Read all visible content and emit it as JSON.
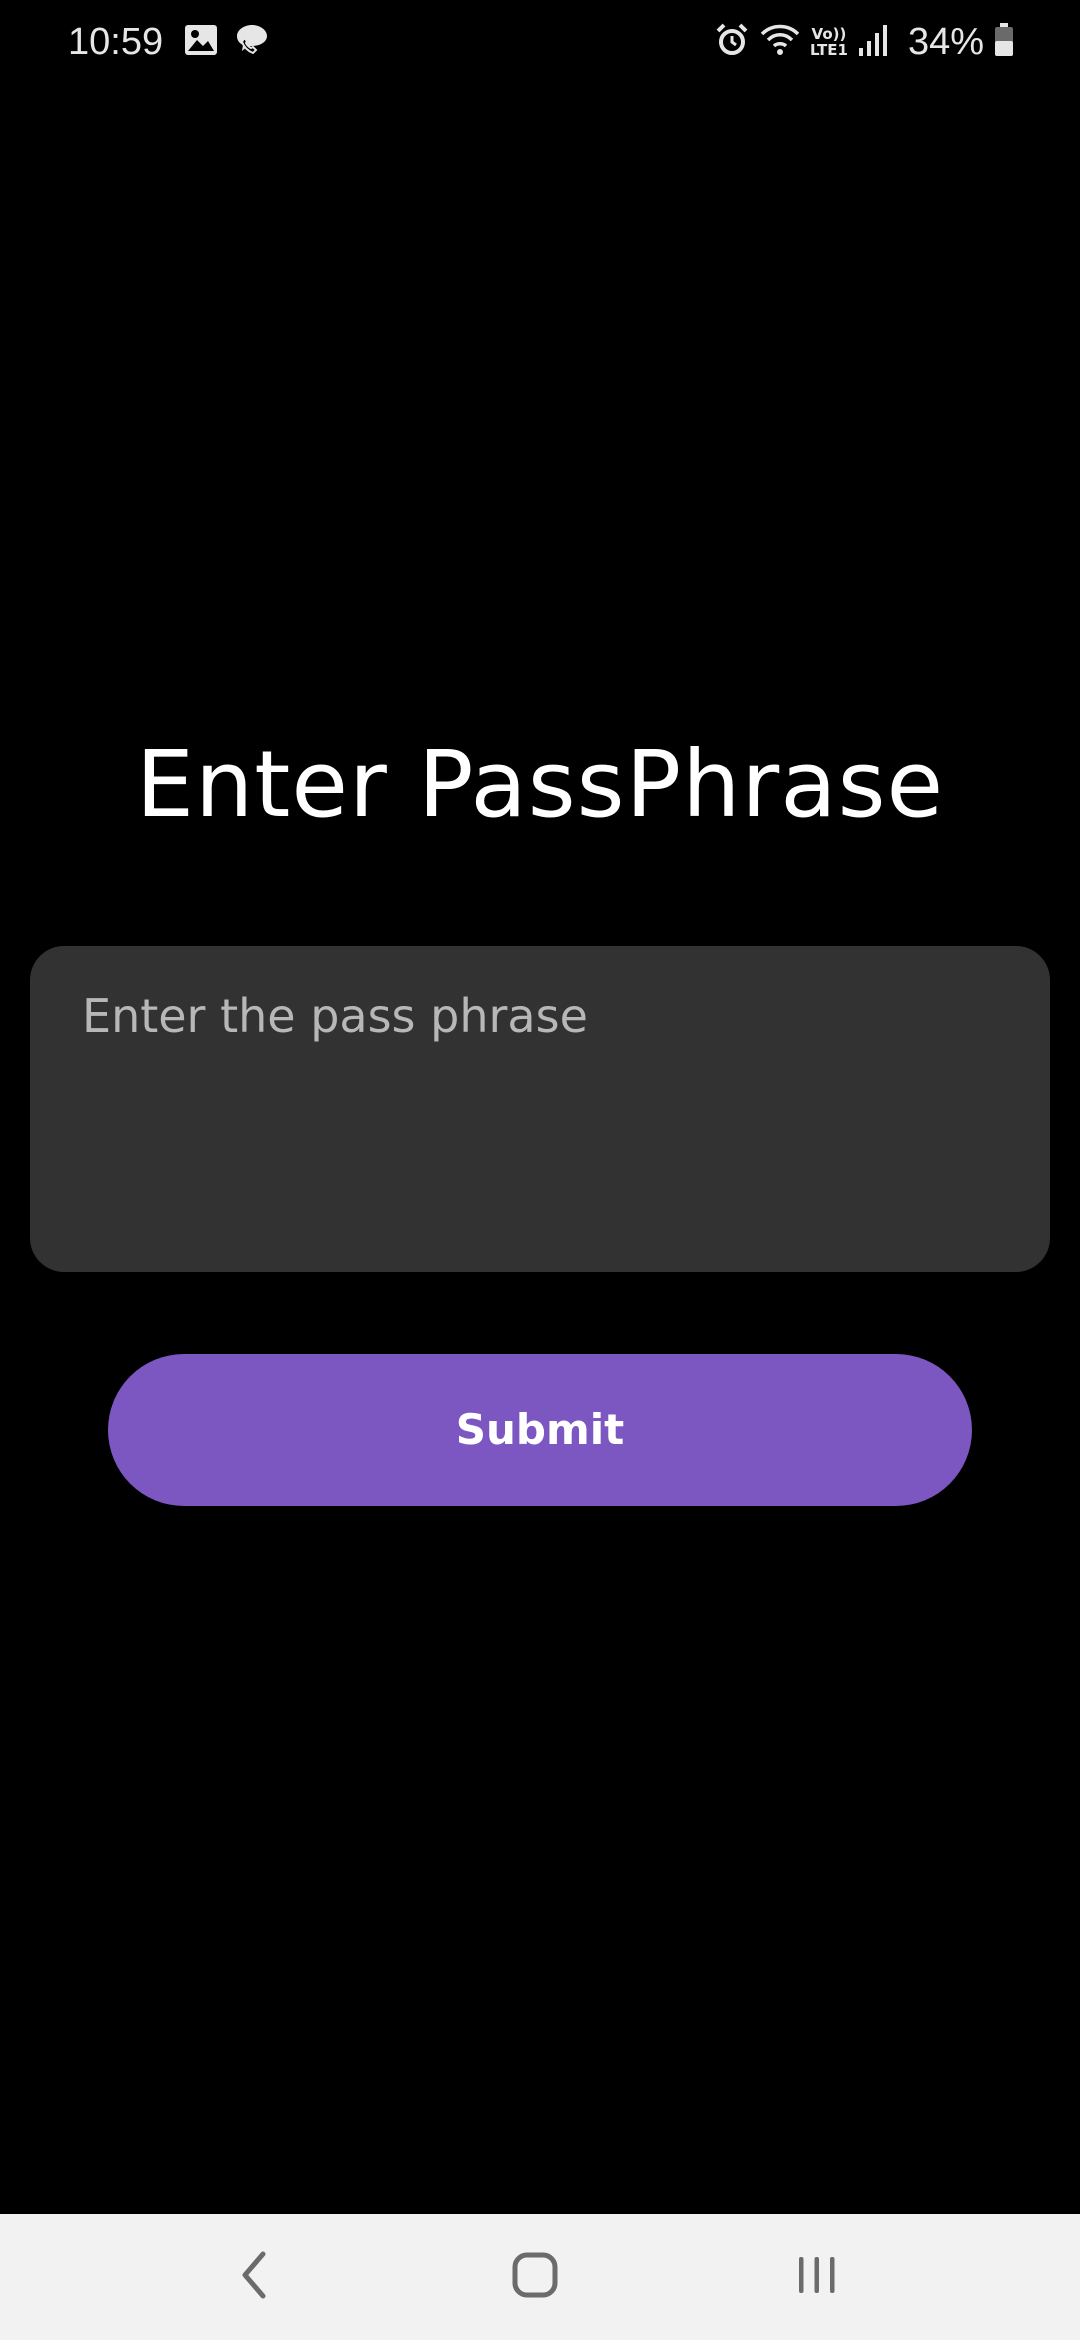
{
  "status_bar": {
    "time": "10:59",
    "battery_percent": "34%",
    "network_label_top": "Vo))",
    "network_label_bottom": "LTE1",
    "icons": [
      "gallery-icon",
      "call-icon",
      "alarm-icon",
      "wifi-icon",
      "lte-icon",
      "signal-icon",
      "battery-icon"
    ]
  },
  "screen": {
    "title": "Enter PassPhrase",
    "input": {
      "placeholder": "Enter the pass phrase",
      "value": ""
    },
    "submit_label": "Submit"
  },
  "nav_bar": {
    "buttons": [
      "back",
      "home",
      "recents"
    ]
  },
  "colors": {
    "background": "#000000",
    "input_background": "#323232",
    "accent": "#7c57c1",
    "nav_background": "#f2f2f2"
  }
}
